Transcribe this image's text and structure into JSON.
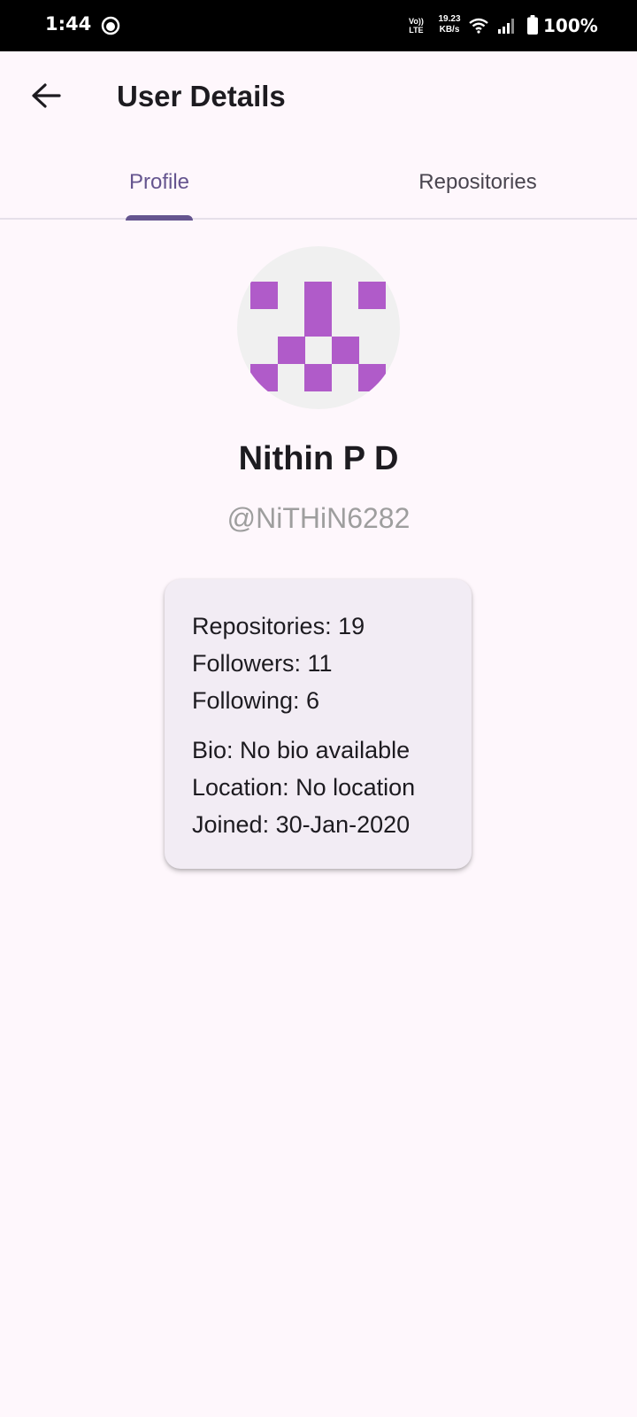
{
  "status_bar": {
    "time": "1:44",
    "volte": "Vo))\nLTE",
    "net_speed": "19.23\nKB/s",
    "battery": "100%",
    "icons": [
      "notification-icon",
      "volte-icon",
      "wifi-icon",
      "signal-icon",
      "battery-icon"
    ]
  },
  "app_bar": {
    "title": "User Details",
    "back_icon": "arrow-back-icon"
  },
  "tabs": [
    {
      "label": "Profile",
      "selected": true
    },
    {
      "label": "Repositories",
      "selected": false
    }
  ],
  "profile": {
    "name": "Nithin P D",
    "username": "@NiTHiN6282",
    "avatar_color": "#b05bc9"
  },
  "stats": {
    "repositories": "Repositories: 19",
    "followers": "Followers: 11",
    "following": "Following: 6",
    "bio": "Bio: No bio available",
    "location": "Location: No location",
    "joined": "Joined: 30-Jan-2020"
  },
  "colors": {
    "accent": "#65558f",
    "background": "#fef7fc",
    "card": "#f2ecf4"
  }
}
